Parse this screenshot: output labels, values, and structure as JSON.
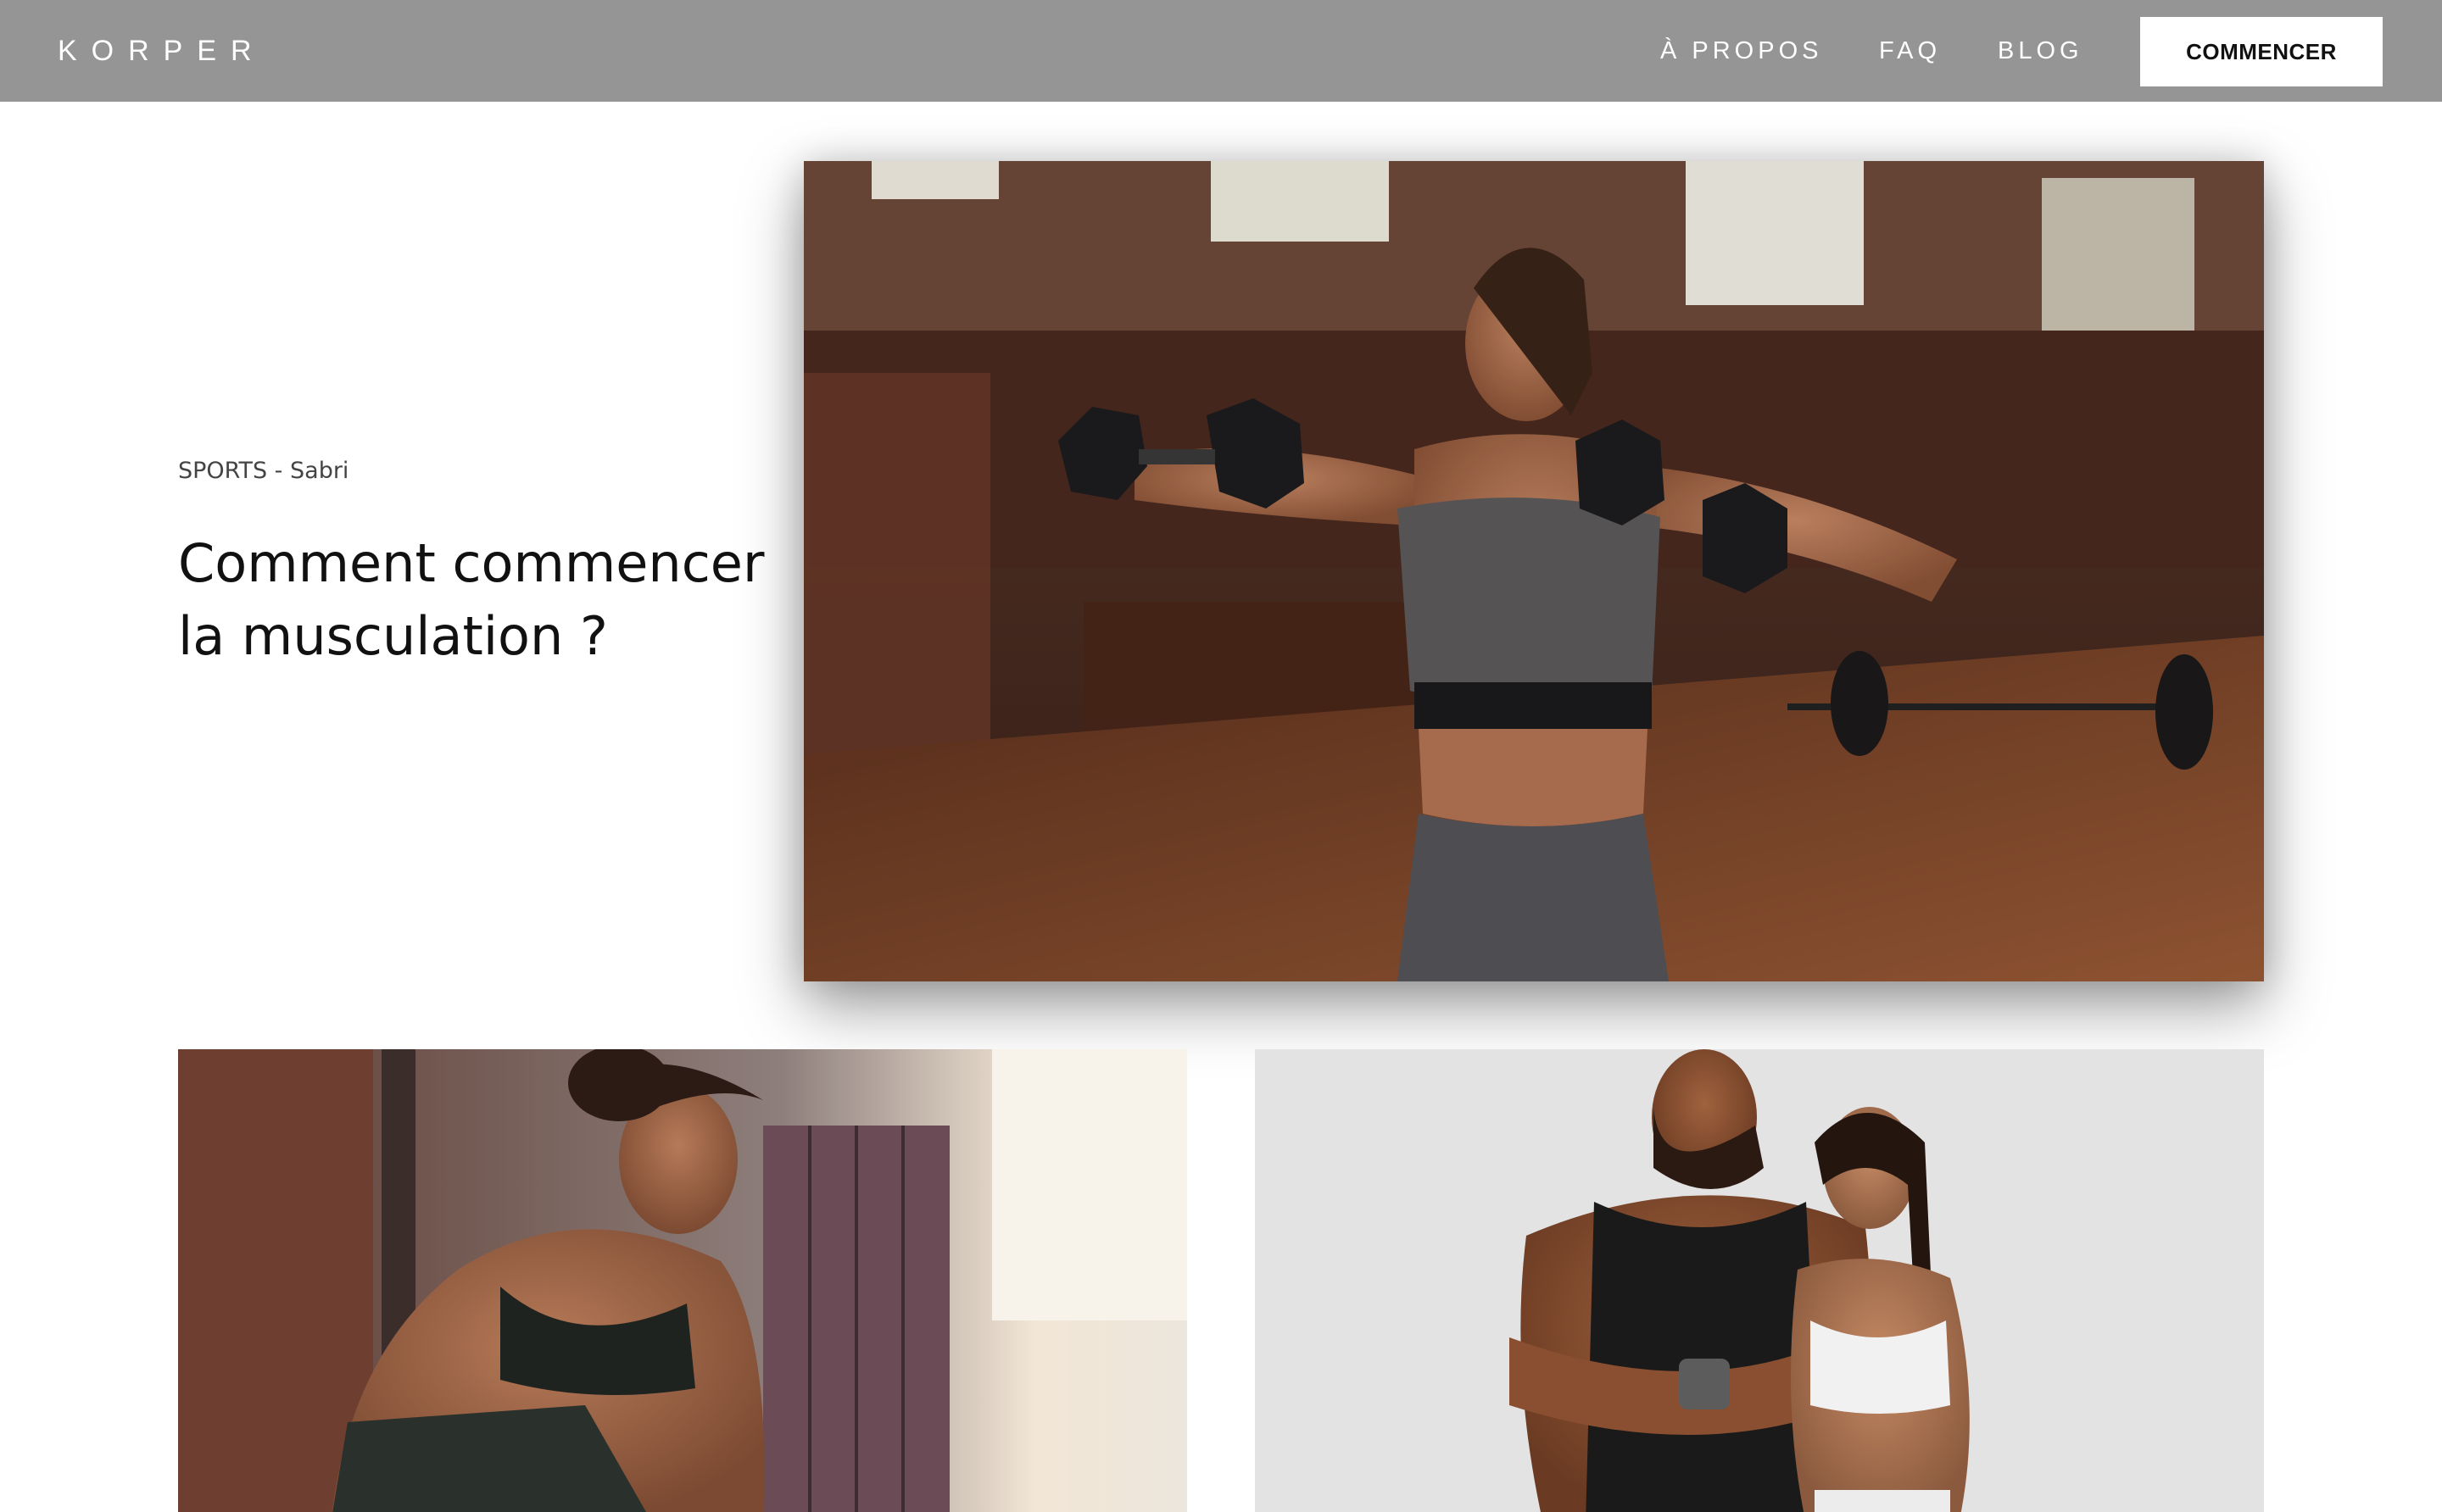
{
  "header": {
    "logo": "KORPER",
    "nav": [
      {
        "label": "À PROPOS"
      },
      {
        "label": "FAQ"
      },
      {
        "label": "BLOG"
      }
    ],
    "cta_label": "COMMENCER"
  },
  "featured": {
    "category": "SPORTS - Sabri",
    "title": "Comment commencer la musculation ?"
  },
  "colors": {
    "navbar_bg": "#959595",
    "page_bg": "#ffffff",
    "cta_bg": "#ffffff",
    "text_dark": "#111111"
  }
}
